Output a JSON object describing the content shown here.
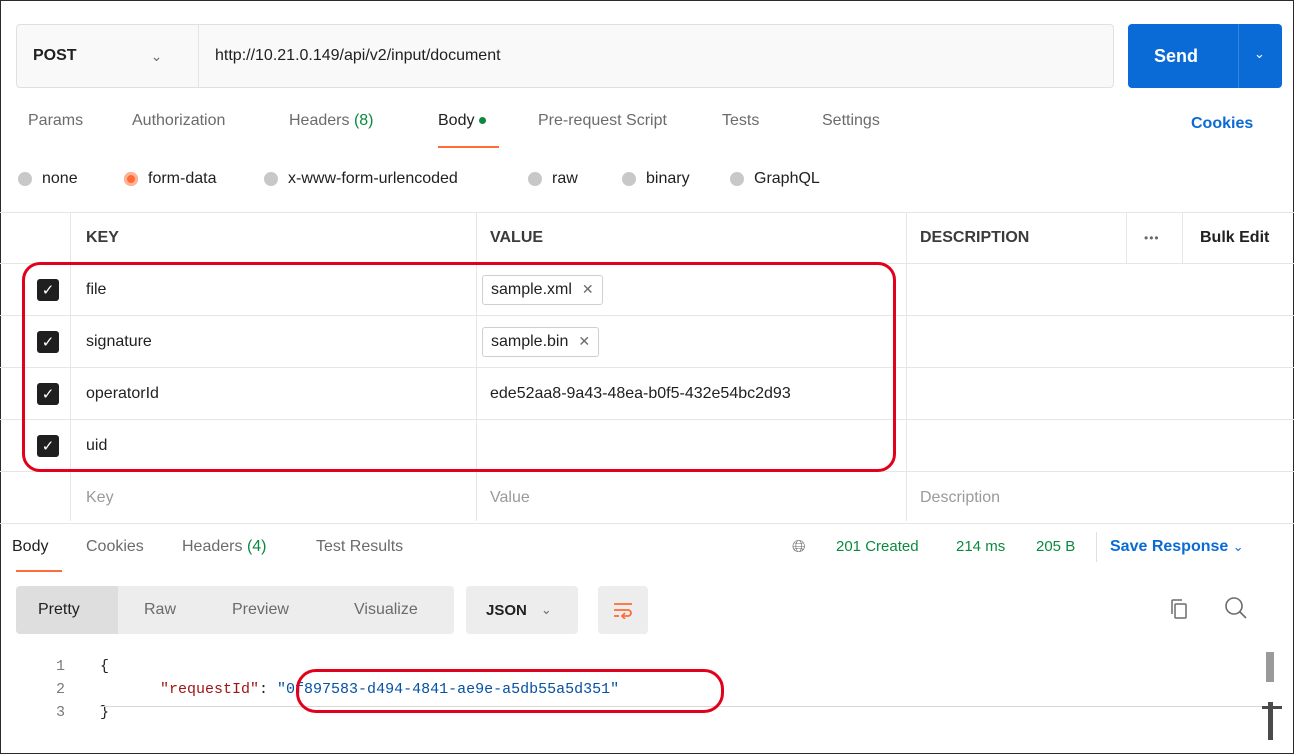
{
  "request": {
    "method": "POST",
    "url": "http://10.21.0.149/api/v2/input/document",
    "send_label": "Send"
  },
  "tabs": {
    "params": "Params",
    "authorization": "Authorization",
    "headers": "Headers",
    "headers_count": "(8)",
    "body": "Body",
    "prerequest": "Pre-request Script",
    "tests": "Tests",
    "settings": "Settings",
    "cookies": "Cookies"
  },
  "body_types": [
    "none",
    "form-data",
    "x-www-form-urlencoded",
    "raw",
    "binary",
    "GraphQL"
  ],
  "body_type_selected": "form-data",
  "table": {
    "headers": {
      "key": "KEY",
      "value": "VALUE",
      "description": "DESCRIPTION",
      "bulk_edit": "Bulk Edit",
      "more": "•••"
    },
    "rows": [
      {
        "key": "file",
        "value": "sample.xml",
        "value_is_file": true
      },
      {
        "key": "signature",
        "value": "sample.bin",
        "value_is_file": true
      },
      {
        "key": "operatorId",
        "value": "ede52aa8-9a43-48ea-b0f5-432e54bc2d93",
        "value_is_file": false
      },
      {
        "key": "uid",
        "value": "",
        "value_is_file": false
      }
    ],
    "placeholders": {
      "key": "Key",
      "value": "Value",
      "description": "Description"
    }
  },
  "response": {
    "tabs": {
      "body": "Body",
      "cookies": "Cookies",
      "headers": "Headers",
      "headers_count": "(4)",
      "test_results": "Test Results"
    },
    "status": "201 Created",
    "time": "214 ms",
    "size": "205 B",
    "save_label": "Save Response",
    "formats": [
      "Pretty",
      "Raw",
      "Preview",
      "Visualize"
    ],
    "format_selected": "Pretty",
    "language": "JSON",
    "code": {
      "line_numbers": [
        "1",
        "2",
        "3"
      ],
      "open": "{",
      "key": "\"requestId\"",
      "colon": ": ",
      "value": "\"0f897583-d494-4841-ae9e-a5db55a5d351\"",
      "close": "}"
    }
  },
  "colors": {
    "accent": "#ff6c37",
    "primary": "#0a6bd6",
    "success": "#0b8a3e",
    "annotation": "#e2001a"
  },
  "icons": [
    "chevron-down-icon",
    "checkbox-checked-icon",
    "close-icon",
    "globe-icon",
    "wrap-lines-icon",
    "copy-icon",
    "search-icon"
  ]
}
